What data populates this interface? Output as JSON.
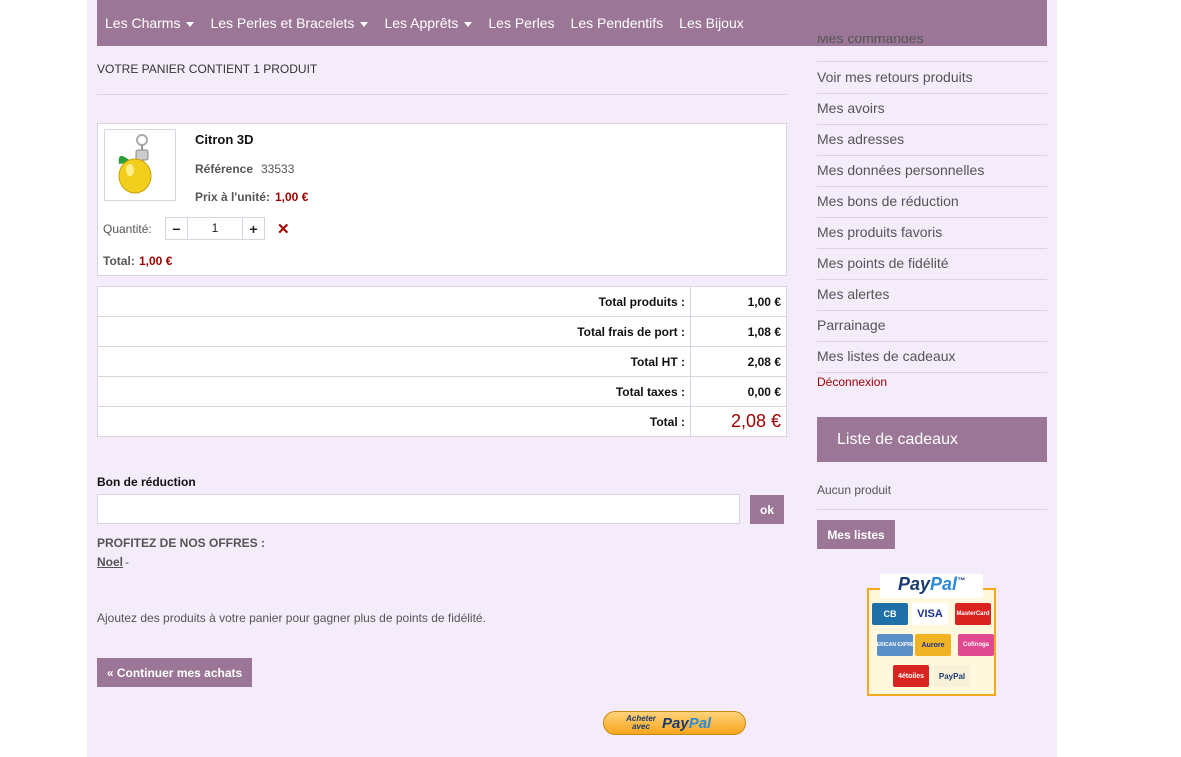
{
  "nav": {
    "items": [
      {
        "label": "Les Charms",
        "dropdown": true
      },
      {
        "label": "Les Perles et Bracelets",
        "dropdown": true
      },
      {
        "label": "Les Apprêts",
        "dropdown": true
      },
      {
        "label": "Les Perles",
        "dropdown": false
      },
      {
        "label": "Les Pendentifs",
        "dropdown": false
      },
      {
        "label": "Les Bijoux",
        "dropdown": false
      }
    ]
  },
  "cart": {
    "title": "VOTRE PANIER CONTIENT 1 PRODUIT",
    "product": {
      "name": "Citron 3D",
      "ref_label": "Référence",
      "ref_value": "33533",
      "price_label": "Prix à l'unité:",
      "price_value": "1,00 €",
      "qty_label": "Quantité:",
      "qty_value": "1",
      "total_label": "Total:",
      "total_value": "1,00 €"
    },
    "totals": [
      {
        "label": "Total produits :",
        "value": "1,00 €"
      },
      {
        "label": "Total frais de port :",
        "value": "1,08 €"
      },
      {
        "label": "Total HT :",
        "value": "2,08 €"
      },
      {
        "label": "Total taxes :",
        "value": "0,00 €"
      },
      {
        "label": "Total :",
        "value": "2,08 €"
      }
    ],
    "voucher": {
      "title": "Bon de réduction",
      "value": "",
      "ok": "ok"
    },
    "offers": {
      "title": "PROFITEZ DE NOS OFFRES :",
      "link": "Noel",
      "separator": "-"
    },
    "loyalty_msg": "Ajoutez des produits à votre panier pour gagner plus de points de fidélité.",
    "continue": "« Continuer mes achats",
    "paypal_checkout": {
      "small": "Acheter avec",
      "brand_a": "Pay",
      "brand_b": "Pal"
    }
  },
  "sidebar": {
    "cut_item": "Mes commandes",
    "items": [
      "Voir mes retours produits",
      "Mes avoirs",
      "Mes adresses",
      "Mes données personnelles",
      "Mes bons de réduction",
      "Mes produits favoris",
      "Mes points de fidélité",
      "Mes alertes",
      "Parrainage",
      "Mes listes de cadeaux"
    ],
    "logout": "Déconnexion",
    "gift": {
      "title": "Liste de cadeaux",
      "empty": "Aucun produit",
      "button": "Mes listes"
    },
    "paypal": {
      "brand_a": "Pay",
      "brand_b": "Pal",
      "tm": "™",
      "cards": [
        {
          "label": "CB",
          "bg": "#1f6fa8",
          "fg": "#ffffff"
        },
        {
          "label": "VISA",
          "bg": "#ffffff",
          "fg": "#1a2f8a"
        },
        {
          "label": "MasterCard",
          "bg": "#d9231e",
          "fg": "#ffffff"
        },
        {
          "label": "AMERICAN EXPRESS",
          "bg": "#5b8fc7",
          "fg": "#ffffff"
        },
        {
          "label": "Aurore",
          "bg": "#f0b323",
          "fg": "#1a2f8a"
        },
        {
          "label": "Cofinoga",
          "bg": "#e0488f",
          "fg": "#ffffff"
        },
        {
          "label": "4étoiles",
          "bg": "#d9231e",
          "fg": "#ffffff"
        },
        {
          "label": "PayPal",
          "bg": "#f6f1d8",
          "fg": "#1b3a6e"
        }
      ]
    }
  }
}
